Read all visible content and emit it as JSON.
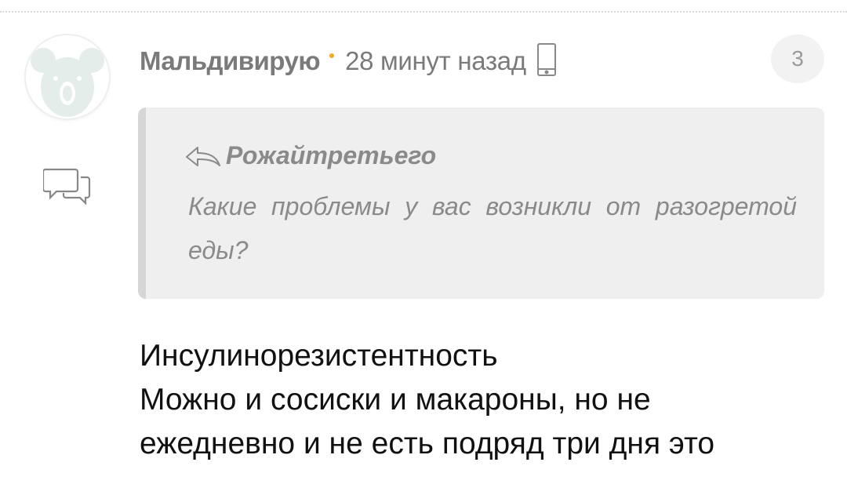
{
  "comment": {
    "author": "Мальдивирую",
    "timestamp": "28 минут назад",
    "rating": "3",
    "icons": {
      "avatar": "koala-avatar-icon",
      "device": "smartphone-icon",
      "reply": "speech-bubbles-icon",
      "quote": "reply-arrow-icon"
    },
    "quote": {
      "author": "Рожайтретьего",
      "text": "Какие проблемы у вас возникли от разогретой еды?"
    },
    "body_lines": [
      "Инсулинорезистентность",
      "Можно и сосиски и макароны, но не",
      "ежедневно и не есть подряд три дня это"
    ]
  },
  "colors": {
    "meta_text": "#7a7a7a",
    "separator_dot": "#f5a623",
    "quote_background": "#efefef",
    "quote_border": "#d6d6d6",
    "body_text": "#111111"
  }
}
